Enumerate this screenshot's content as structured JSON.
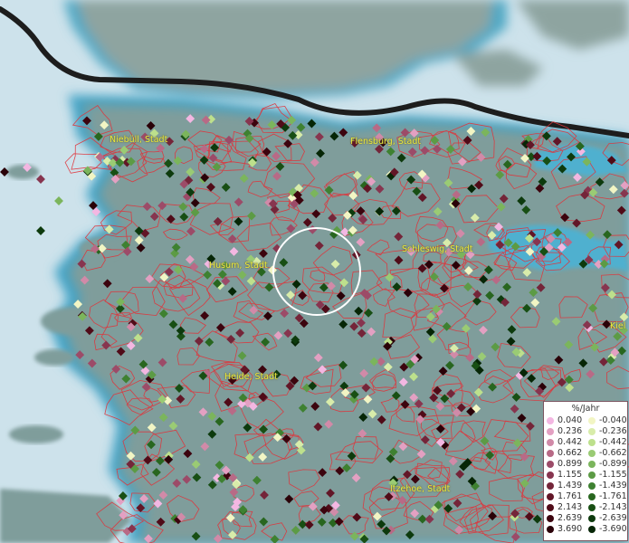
{
  "towns": [
    {
      "name": "Niebüll, Stadt"
    },
    {
      "name": "Flensburg, Stadt"
    },
    {
      "name": "Schleswig, Stadt"
    },
    {
      "name": "Husum, Stadt"
    },
    {
      "name": "Kiel"
    },
    {
      "name": "Heide, Stadt"
    },
    {
      "name": "Itzehoe, Stadt"
    }
  ],
  "legend": {
    "title": "%/Jahr",
    "positive": [
      {
        "label": "0.040",
        "color": "#f3b7e2"
      },
      {
        "label": "0.236",
        "color": "#e3a0c2"
      },
      {
        "label": "0.442",
        "color": "#d18aa8"
      },
      {
        "label": "0.662",
        "color": "#b86a86"
      },
      {
        "label": "0.899",
        "color": "#9c4b68"
      },
      {
        "label": "1.155",
        "color": "#87354f"
      },
      {
        "label": "1.439",
        "color": "#742539"
      },
      {
        "label": "1.761",
        "color": "#621627"
      },
      {
        "label": "2.143",
        "color": "#500b18"
      },
      {
        "label": "2.639",
        "color": "#3c040e"
      },
      {
        "label": "3.690",
        "color": "#2a0108"
      }
    ],
    "negative": [
      {
        "label": "-0.040",
        "color": "#f2f5c4"
      },
      {
        "label": "-0.236",
        "color": "#d8ecaa"
      },
      {
        "label": "-0.442",
        "color": "#bde08c"
      },
      {
        "label": "-0.662",
        "color": "#9acb74"
      },
      {
        "label": "-0.899",
        "color": "#7bb55c"
      },
      {
        "label": "-1.155",
        "color": "#5c9b45"
      },
      {
        "label": "-1.439",
        "color": "#3e8131"
      },
      {
        "label": "-1.761",
        "color": "#28661f"
      },
      {
        "label": "-2.143",
        "color": "#184f14"
      },
      {
        "label": "-2.639",
        "color": "#0d3a0d"
      },
      {
        "label": "-3.690",
        "color": "#062606"
      }
    ]
  }
}
